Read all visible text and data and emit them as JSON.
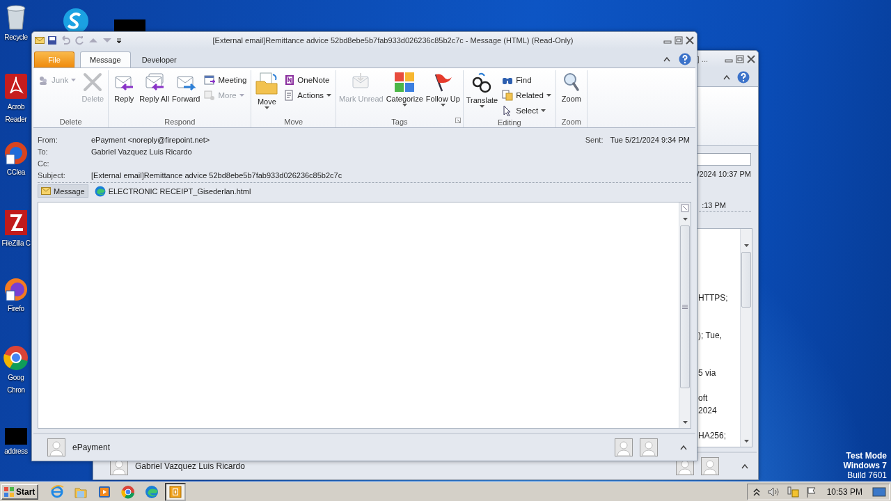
{
  "desktop": {
    "icons": [
      {
        "kind": "app",
        "lines": [
          "Recycle"
        ]
      },
      {
        "kind": "app"
      },
      {
        "kind": "redacted"
      },
      {
        "kind": "app",
        "lines": [
          "Acrob",
          "Reader"
        ]
      },
      {
        "kind": "app",
        "lines": [
          "CClea"
        ]
      },
      {
        "kind": "app",
        "lines": [
          "FileZilla C"
        ]
      },
      {
        "kind": "app",
        "lines": [
          "Firefo"
        ]
      },
      {
        "kind": "app",
        "lines": [
          "Goog",
          "Chron"
        ]
      },
      {
        "kind": "redacted",
        "lines": [
          "address"
        ]
      }
    ],
    "os_notice": [
      "Test Mode",
      "Windows 7",
      "Build 7601"
    ]
  },
  "back_window": {
    "title": "] ...",
    "received": "/2024 10:37 PM",
    "sent": ":13 PM",
    "body_lines": [
      "HTTPS;",
      "); Tue,",
      "5 via",
      "oft",
      "2024",
      "HA256;"
    ],
    "people": [
      "Gabriel Vazquez Luis Ricardo"
    ]
  },
  "window": {
    "title": "[External email]Remittance advice 52bd8ebe5b7fab933d026236c85b2c7c -  Message (HTML) (Read-Only)",
    "tabs": [
      {
        "label": "File",
        "kind": "file",
        "selected": false
      },
      {
        "label": "Message",
        "kind": "tab",
        "selected": true
      },
      {
        "label": "Developer",
        "kind": "tab",
        "selected": false
      }
    ],
    "ribbon": [
      {
        "label": "Delete",
        "items": [
          {
            "label": "Junk",
            "kind": "small",
            "disabled": true,
            "dropdown": true
          },
          {
            "label": "Delete",
            "kind": "large",
            "disabled": true,
            "dropdown": false
          }
        ]
      },
      {
        "label": "Respond",
        "items": [
          {
            "label": "Reply",
            "kind": "large",
            "disabled": false,
            "dropdown": false
          },
          {
            "label": "Reply All",
            "kind": "large",
            "disabled": false,
            "dropdown": false
          },
          {
            "label": "Forward",
            "kind": "large",
            "disabled": false,
            "dropdown": false
          },
          {
            "label": "Meeting",
            "kind": "small",
            "disabled": false,
            "dropdown": false
          },
          {
            "label": "More",
            "kind": "small",
            "disabled": true,
            "dropdown": true
          }
        ]
      },
      {
        "label": "Move",
        "items": [
          {
            "label": "Move",
            "kind": "large",
            "disabled": false,
            "dropdown": true
          },
          {
            "label": "OneNote",
            "kind": "small",
            "disabled": false,
            "dropdown": false
          },
          {
            "label": "Actions",
            "kind": "small",
            "disabled": false,
            "dropdown": true
          }
        ]
      },
      {
        "label": "Tags",
        "launcher": true,
        "items": [
          {
            "label": "Mark Unread",
            "kind": "large",
            "disabled": true,
            "dropdown": false
          },
          {
            "label": "Categorize",
            "kind": "large",
            "disabled": false,
            "dropdown": true
          },
          {
            "label": "Follow Up",
            "kind": "large",
            "disabled": false,
            "dropdown": true
          }
        ]
      },
      {
        "label": "Editing",
        "items": [
          {
            "label": "Translate",
            "kind": "large",
            "disabled": false,
            "dropdown": true
          },
          {
            "label": "Find",
            "kind": "small",
            "disabled": false,
            "dropdown": false
          },
          {
            "label": "Related",
            "kind": "small",
            "disabled": false,
            "dropdown": true
          },
          {
            "label": "Select",
            "kind": "small",
            "disabled": false,
            "dropdown": true
          }
        ]
      },
      {
        "label": "Zoom",
        "items": [
          {
            "label": "Zoom",
            "kind": "large",
            "disabled": false,
            "dropdown": false
          }
        ]
      }
    ],
    "header": {
      "fields": [
        {
          "label": "From:",
          "value": "ePayment <noreply@firepoint.net>"
        },
        {
          "label": "To:",
          "value": "Gabriel Vazquez Luis Ricardo"
        },
        {
          "label": "Cc:"
        },
        {
          "label": "Subject:",
          "value": "[External email]Remittance advice 52bd8ebe5b7fab933d026236c85b2c7c"
        }
      ],
      "sent": {
        "label": "Sent:",
        "value": "Tue 5/21/2024 9:34 PM"
      }
    },
    "attachments": [
      {
        "label": "Message",
        "kind": "message",
        "selected": true
      },
      {
        "label": "ELECTRONIC RECEIPT_Gisederlan.html",
        "kind": "file",
        "selected": false
      }
    ],
    "people_pane": {
      "name": "ePayment"
    }
  },
  "taskbar": {
    "start": "Start",
    "apps": [
      {
        "selected": false
      },
      {
        "selected": false
      },
      {
        "selected": false
      },
      {
        "selected": false
      },
      {
        "selected": false
      },
      {
        "selected": true
      }
    ],
    "clock": "10:53 PM"
  }
}
